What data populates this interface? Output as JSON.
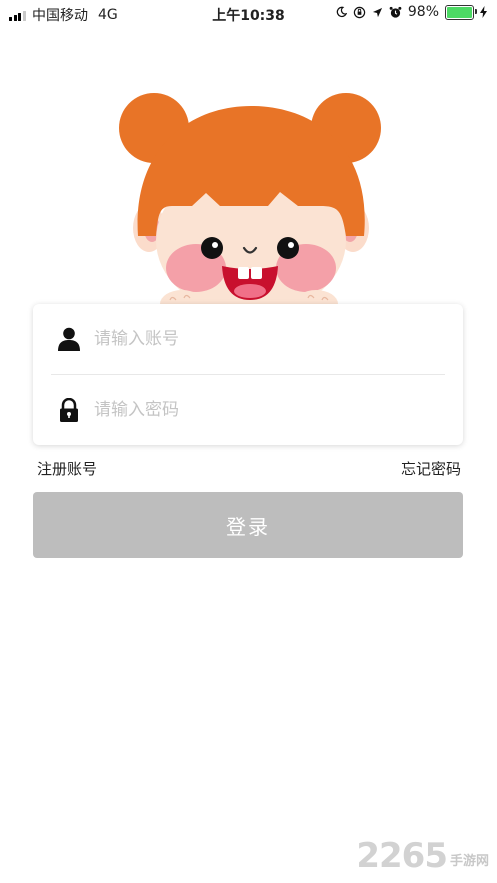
{
  "status_bar": {
    "carrier": "中国移动",
    "network": "4G",
    "time": "上午10:38",
    "battery_percent": "98%",
    "battery_level": 0.98,
    "battery_color": "#4cd964",
    "icons": [
      "signal-icon",
      "moon-icon",
      "orientation-lock-icon",
      "location-arrow-icon",
      "alarm-icon",
      "battery-icon",
      "charging-bolt-icon"
    ]
  },
  "login": {
    "username_placeholder": "请输入账号",
    "password_placeholder": "请输入密码",
    "username_icon": "user-icon",
    "password_icon": "lock-icon"
  },
  "links": {
    "register": "注册账号",
    "forgot_password": "忘记密码"
  },
  "login_button": {
    "label": "登录",
    "color": "#bdbdbd"
  },
  "watermark": {
    "digits": "2265",
    "suffix": "手游网"
  }
}
